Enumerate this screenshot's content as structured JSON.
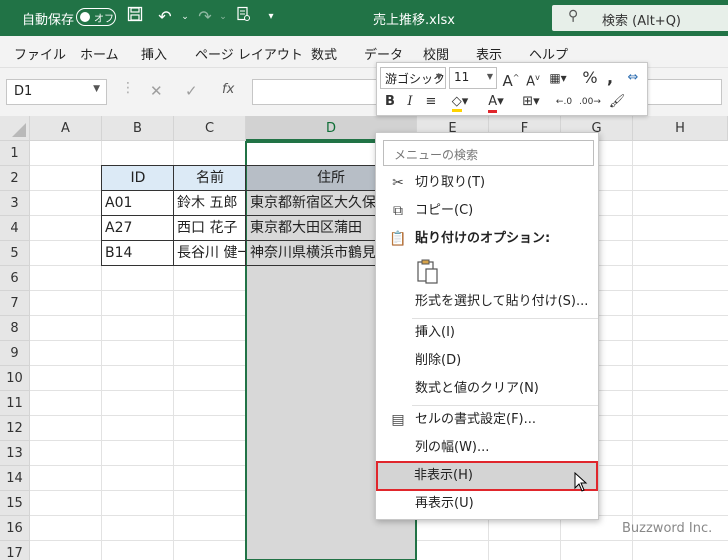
{
  "titlebar": {
    "autosave_label": "自動保存",
    "toggle_label": "オフ",
    "filename": "売上推移.xlsx",
    "search_placeholder": "検索 (Alt+Q)"
  },
  "ribbon": {
    "tabs": [
      "ファイル",
      "ホーム",
      "挿入",
      "ページ レイアウト",
      "数式",
      "データ",
      "校閲",
      "表示",
      "ヘルプ"
    ]
  },
  "formula": {
    "namebox": "D1",
    "fx": "fx",
    "value": ""
  },
  "columns": [
    "A",
    "B",
    "C",
    "D",
    "E",
    "F",
    "G",
    "H"
  ],
  "rows": [
    "1",
    "2",
    "3",
    "4",
    "5",
    "6",
    "7",
    "8",
    "9",
    "10",
    "11",
    "12",
    "13",
    "14",
    "15",
    "16",
    "17"
  ],
  "table": {
    "headers": [
      "ID",
      "名前",
      "住所"
    ],
    "rows": [
      [
        "A01",
        "鈴木 五郎",
        "東京都新宿区大久保"
      ],
      [
        "A27",
        "西口 花子",
        "東京都大田区蒲田"
      ],
      [
        "B14",
        "長谷川 健一",
        "神奈川県横浜市鶴見区"
      ]
    ]
  },
  "minitoolbar": {
    "font": "游ゴシック",
    "size": "11"
  },
  "context_menu": {
    "search_placeholder": "メニューの検索",
    "cut": "切り取り(T)",
    "copy": "コピー(C)",
    "paste_options": "貼り付けのオプション:",
    "paste_special": "形式を選択して貼り付け(S)...",
    "insert": "挿入(I)",
    "delete": "削除(D)",
    "clear": "数式と値のクリア(N)",
    "format_cells": "セルの書式設定(F)...",
    "col_width": "列の幅(W)...",
    "hide": "非表示(H)",
    "unhide": "再表示(U)"
  },
  "watermark": "Buzzword Inc.",
  "colors": {
    "excel_green": "#217346",
    "highlight_border": "#e0262c",
    "header_fill": "#dceaf6"
  }
}
